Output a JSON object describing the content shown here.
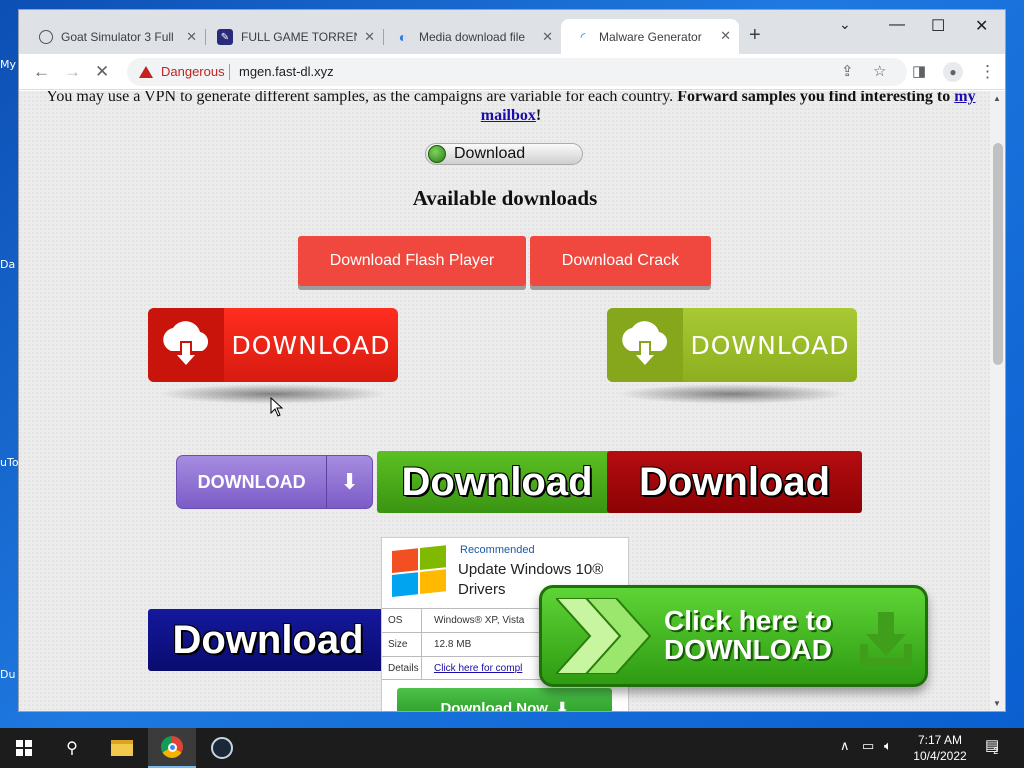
{
  "desktop": {
    "labels": [
      "My",
      "Da",
      "uTo",
      "Du"
    ]
  },
  "browser": {
    "tabs": [
      {
        "title": "Goat Simulator 3 Full",
        "active": false
      },
      {
        "title": "FULL GAME TORRENT",
        "active": false
      },
      {
        "title": "Media download file",
        "active": false
      },
      {
        "title": "Malware Generator",
        "active": true
      }
    ],
    "new_tab": "+",
    "controls": {
      "minimize": "⌄",
      "restore": "—",
      "maximize": "☐",
      "close": "✕"
    },
    "toolbar": {
      "security_label": "Dangerous",
      "url": "mgen.fast-dl.xyz"
    }
  },
  "page": {
    "intro_text": "You may use a VPN to generate different samples, as the campaigns are variable for each country.",
    "intro_bold": "Forward samples you find interesting to",
    "intro_link": "my mailbox",
    "intro_end": "!",
    "small_download_label": "Download",
    "available_heading": "Available downloads",
    "flash_button": "Download Flash Player",
    "crack_button": "Download Crack",
    "red_download": "DOWNLOAD",
    "lime_download": "DOWNLOAD",
    "purple_download": "DOWNLOAD",
    "green_download": "Download",
    "darkred_download": "Download",
    "navy_download": "Download",
    "ad": {
      "recommended": "Recommended",
      "title": "Update Windows 10® Drivers",
      "rows": [
        {
          "key": "OS",
          "value": "Windows® XP, Vista"
        },
        {
          "key": "Size",
          "value": "12.8 MB"
        },
        {
          "key": "Details",
          "value": "Click here for compl"
        }
      ],
      "download_now": "Download Now"
    },
    "click_here_line1": "Click here to",
    "click_here_line2": "DOWNLOAD"
  },
  "taskbar": {
    "time": "7:17 AM",
    "date": "10/4/2022",
    "notifications": "2"
  },
  "colors": {
    "danger": "#c5221f",
    "flat_red": "#f0483e",
    "big_red": "#e8271b",
    "lime": "#9cbf2a",
    "green": "#4aa81f",
    "dark_red": "#a5070a",
    "navy": "#10128a"
  }
}
